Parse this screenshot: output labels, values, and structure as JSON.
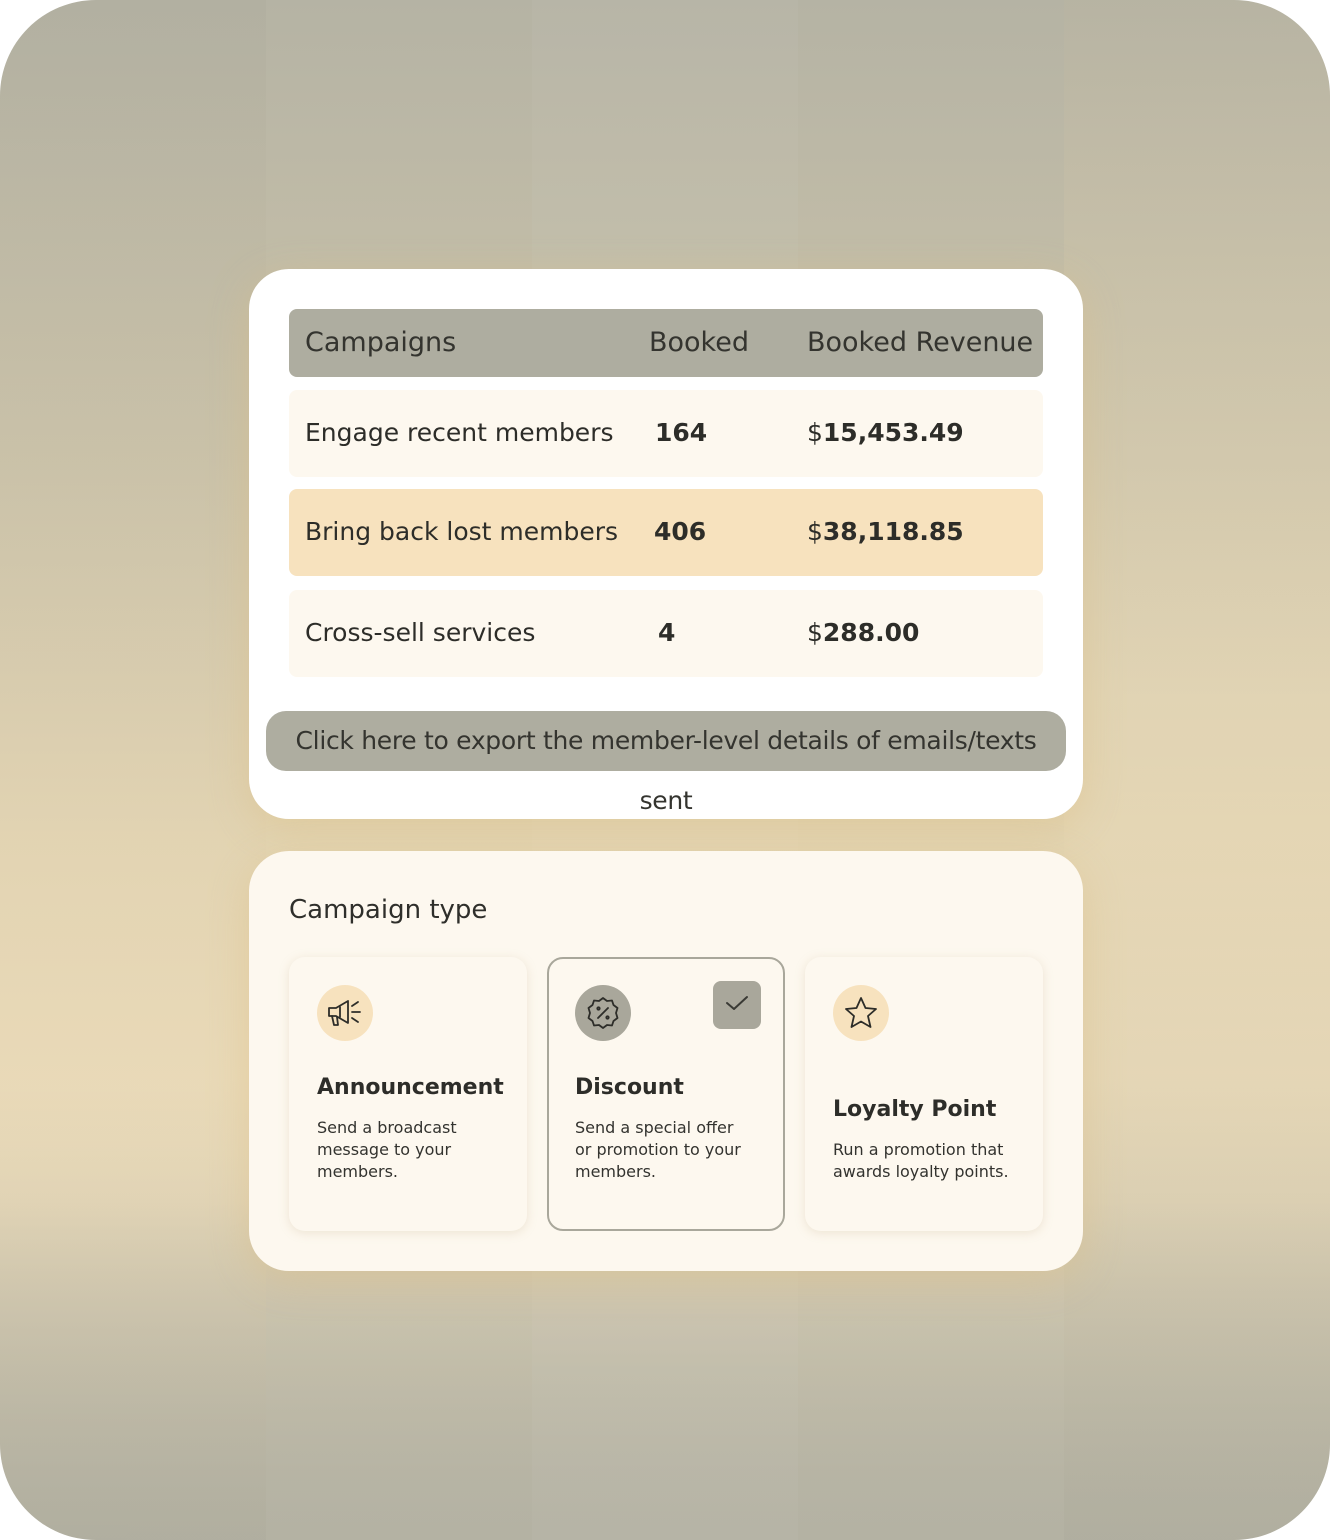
{
  "table": {
    "headers": [
      "Campaigns",
      "Booked",
      "Booked Revenue"
    ],
    "rows": [
      {
        "campaign": "Engage recent members",
        "booked": "164",
        "currency": "$",
        "revenue": "15,453.49",
        "highlighted": false
      },
      {
        "campaign": "Bring back lost members",
        "booked": "406",
        "currency": "$",
        "revenue": "38,118.85",
        "highlighted": true
      },
      {
        "campaign": "Cross-sell services",
        "booked": "4",
        "currency": "$",
        "revenue": "288.00",
        "highlighted": false
      }
    ],
    "export_label": "Click here to export the member-level details of emails/texts sent"
  },
  "campaign_type": {
    "title": "Campaign type",
    "options": [
      {
        "title": "Announcement",
        "description": "Send a broadcast message to your members.",
        "icon": "megaphone-icon",
        "selected": false
      },
      {
        "title": "Discount",
        "description": "Send a special offer or promotion to your members.",
        "icon": "discount-badge-icon",
        "selected": true
      },
      {
        "title": "Loyalty Point",
        "description": "Run a promotion that awards loyalty points.",
        "icon": "star-icon",
        "selected": false
      }
    ]
  },
  "colors": {
    "header_bg": "#aeada0",
    "highlight_row": "#f7e2be",
    "card_bg": "#fdf8ef"
  }
}
